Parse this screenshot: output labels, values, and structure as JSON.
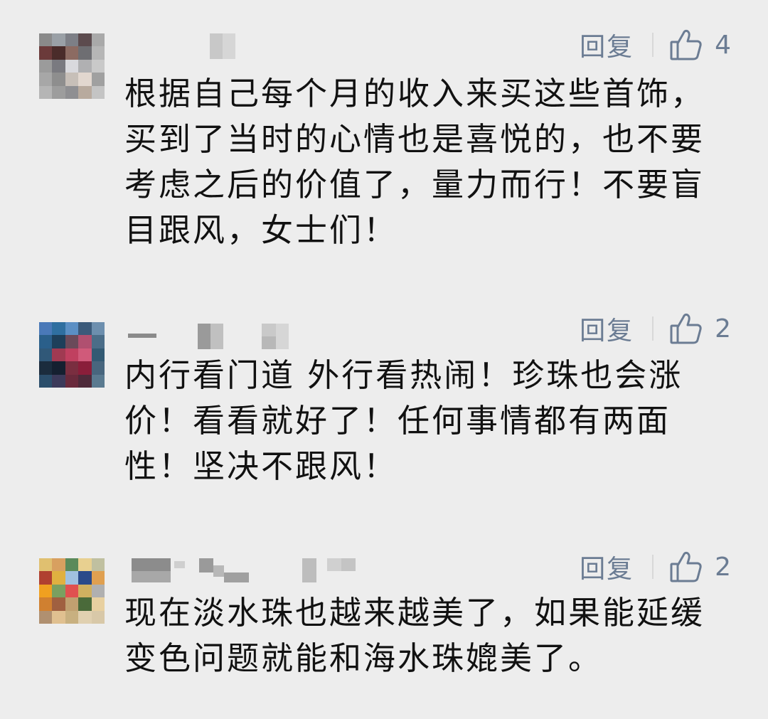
{
  "comments": [
    {
      "reply_label": "回复",
      "likes": "4",
      "text": "根据自己每个月的收入来买这些首饰，买到了当时的心情也是喜悦的，也不要考虑之后的价值了，量力而行！不要盲目跟风，女士们！"
    },
    {
      "reply_label": "回复",
      "likes": "2",
      "text": "内行看门道 外行看热闹！珍珠也会涨价！看看就好了！任何事情都有两面性！坚决不跟风！"
    },
    {
      "reply_label": "回复",
      "likes": "2",
      "text": "现在淡水珠也越来越美了，如果能延缓变色问题就能和海水珠媲美了。"
    }
  ],
  "colors": {
    "background": "#ededed",
    "action_text": "#6b7c93",
    "comment_text": "#111111"
  },
  "icons": {
    "like": "thumbs-up-icon"
  }
}
